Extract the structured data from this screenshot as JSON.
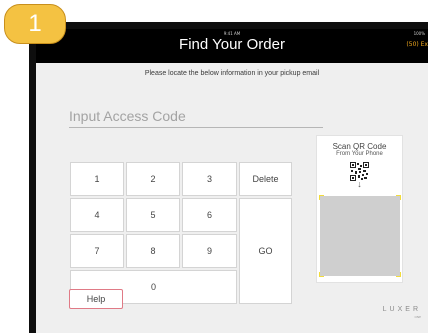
{
  "step_badge": "1",
  "status_bar": {
    "time": "9:41 AM",
    "battery": "100%"
  },
  "header": {
    "title": "Find Your Order",
    "exit_label": "(50) Ex"
  },
  "instruction": "Please locate the below information in your pickup email",
  "code_input": {
    "placeholder": "Input Access Code",
    "value": ""
  },
  "keypad": {
    "k1": "1",
    "k2": "2",
    "k3": "3",
    "delete": "Delete",
    "k4": "4",
    "k5": "5",
    "k6": "6",
    "go": "GO",
    "k7": "7",
    "k8": "8",
    "k9": "9",
    "k0": "0"
  },
  "qr_panel": {
    "title": "Scan QR Code",
    "subtitle": "From Your Phone",
    "arrow": "↓",
    "icon": "qr-code-icon"
  },
  "help_label": "Help",
  "logo": {
    "text": "LUXER",
    "subtext": "ONE"
  },
  "colors": {
    "badge": "#f4c242",
    "exit": "#f0a81e",
    "help_border": "#e07a86",
    "scan_corners": "#f2dc3b"
  }
}
